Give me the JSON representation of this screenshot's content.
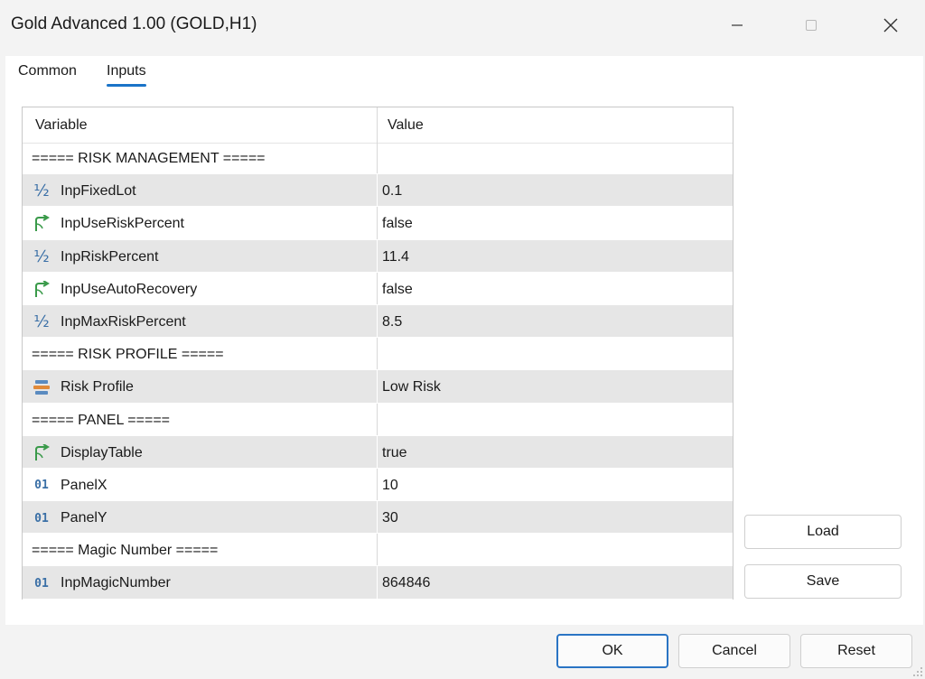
{
  "window": {
    "title": "Gold Advanced 1.00 (GOLD,H1)",
    "minimize_icon": "minimize-icon",
    "maximize_icon": "maximize-icon",
    "close_icon": "close-icon"
  },
  "tabs": [
    {
      "label": "Common",
      "active": false
    },
    {
      "label": "Inputs",
      "active": true
    }
  ],
  "accent_color": "#1a73c8",
  "grid": {
    "headers": {
      "variable": "Variable",
      "value": "Value"
    },
    "rows": [
      {
        "type": "section",
        "name": "===== RISK MANAGEMENT =====",
        "value": "",
        "icon": ""
      },
      {
        "type": "param",
        "icon": "double-icon",
        "name": "InpFixedLot",
        "value": "0.1"
      },
      {
        "type": "param",
        "icon": "bool-icon",
        "name": "InpUseRiskPercent",
        "value": "false"
      },
      {
        "type": "param",
        "icon": "double-icon",
        "name": "InpRiskPercent",
        "value": "11.4"
      },
      {
        "type": "param",
        "icon": "bool-icon",
        "name": "InpUseAutoRecovery",
        "value": "false"
      },
      {
        "type": "param",
        "icon": "double-icon",
        "name": "InpMaxRiskPercent",
        "value": "8.5"
      },
      {
        "type": "section",
        "name": "===== RISK PROFILE =====",
        "value": "",
        "icon": ""
      },
      {
        "type": "param",
        "icon": "enum-icon",
        "name": "Risk Profile",
        "value": "Low Risk"
      },
      {
        "type": "section",
        "name": "===== PANEL =====",
        "value": "",
        "icon": ""
      },
      {
        "type": "param",
        "icon": "bool-icon",
        "name": "DisplayTable",
        "value": "true"
      },
      {
        "type": "param",
        "icon": "int-icon",
        "name": "PanelX",
        "value": "10"
      },
      {
        "type": "param",
        "icon": "int-icon",
        "name": "PanelY",
        "value": "30"
      },
      {
        "type": "section",
        "name": "===== Magic Number =====",
        "value": "",
        "icon": ""
      },
      {
        "type": "param",
        "icon": "int-icon",
        "name": "InpMagicNumber",
        "value": "864846"
      }
    ]
  },
  "side_buttons": {
    "load": "Load",
    "save": "Save"
  },
  "footer_buttons": {
    "ok": "OK",
    "cancel": "Cancel",
    "reset": "Reset"
  }
}
